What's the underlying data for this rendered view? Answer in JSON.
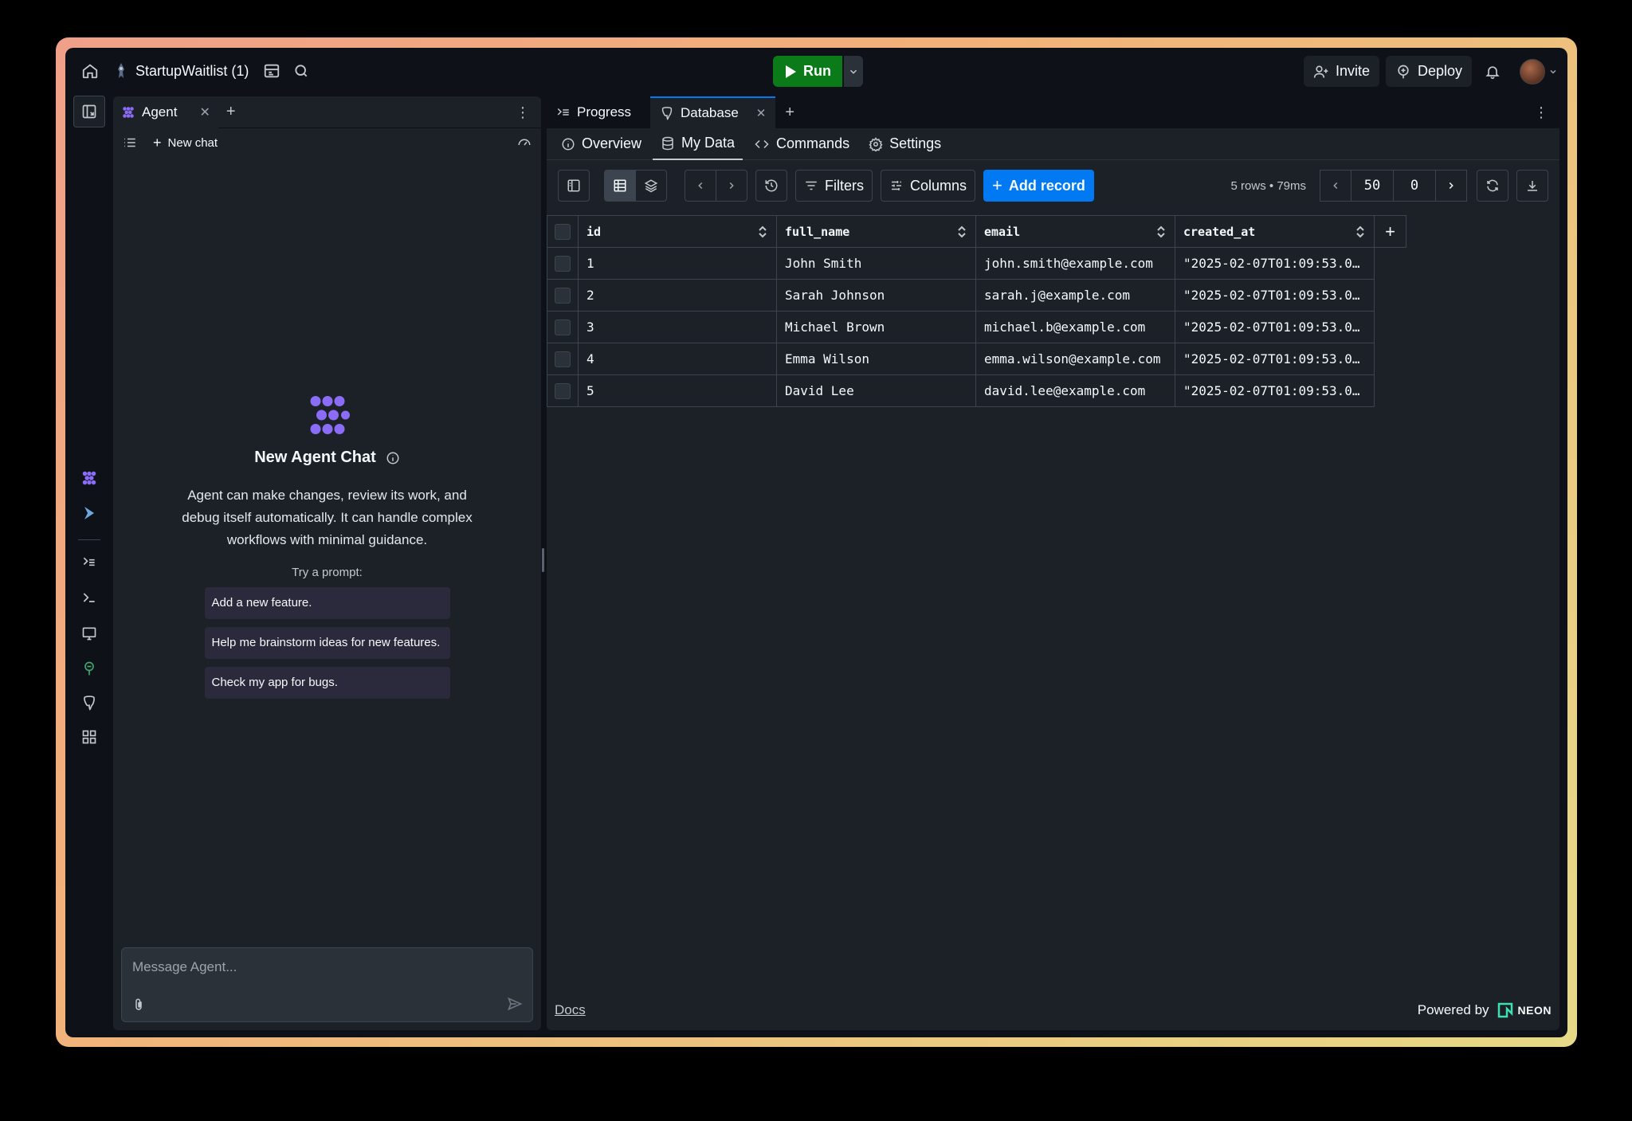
{
  "topbar": {
    "project_name": "StartupWaitlist (1)",
    "run_label": "Run",
    "invite_label": "Invite",
    "deploy_label": "Deploy"
  },
  "agent": {
    "tab_label": "Agent",
    "new_chat_label": "New chat",
    "title": "New Agent Chat",
    "description": "Agent can make changes, review its work, and debug itself automatically. It can handle complex workflows with minimal guidance.",
    "try_label": "Try a prompt:",
    "prompts": [
      "Add a new feature.",
      "Help me brainstorm ideas for new features.",
      "Check my app for bugs."
    ],
    "message_placeholder": "Message Agent..."
  },
  "db": {
    "tabs": [
      "Progress",
      "Database"
    ],
    "subtabs": [
      "Overview",
      "My Data",
      "Commands",
      "Settings"
    ],
    "filters_label": "Filters",
    "columns_label": "Columns",
    "add_record_label": "Add record",
    "rows_info": "5 rows • 79ms",
    "page_size": "50",
    "page_offset": "0",
    "columns": [
      "id",
      "full_name",
      "email",
      "created_at"
    ],
    "rows": [
      [
        "1",
        "John Smith",
        "john.smith@example.com",
        "\"2025-02-07T01:09:53.0…"
      ],
      [
        "2",
        "Sarah Johnson",
        "sarah.j@example.com",
        "\"2025-02-07T01:09:53.0…"
      ],
      [
        "3",
        "Michael Brown",
        "michael.b@example.com",
        "\"2025-02-07T01:09:53.0…"
      ],
      [
        "4",
        "Emma Wilson",
        "emma.wilson@example.com",
        "\"2025-02-07T01:09:53.0…"
      ],
      [
        "5",
        "David Lee",
        "david.lee@example.com",
        "\"2025-02-07T01:09:53.0…"
      ]
    ],
    "docs_label": "Docs",
    "powered_by": "Powered by",
    "neon_label": "NEON"
  },
  "colors": {
    "accent_blue": "#0079f2",
    "run_green": "#0b7a18",
    "agent_purple": "#8b6cf7"
  }
}
